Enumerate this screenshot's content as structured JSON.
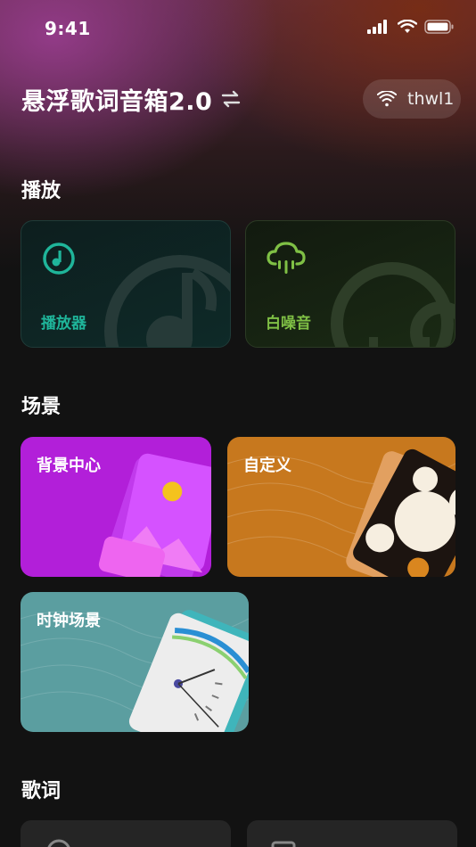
{
  "status_bar": {
    "time": "9:41"
  },
  "header": {
    "title": "悬浮歌词音箱2.0",
    "device_name": "thwl1"
  },
  "sections": {
    "play": "播放",
    "scene": "场景",
    "lyrics": "歌词"
  },
  "play_cards": {
    "player": {
      "label": "播放器",
      "color": "#1fb59a"
    },
    "white_noise": {
      "label": "白噪音",
      "color": "#7fc045"
    }
  },
  "scene_cards": {
    "background_center": {
      "label": "背景中心",
      "color": "#b21fd9"
    },
    "custom": {
      "label": "自定义",
      "color": "#c7781e"
    },
    "clock_scene": {
      "label": "时钟场景",
      "color": "#5b9ea0"
    }
  },
  "icons": {
    "signal": "cellular-signal-icon",
    "wifi": "wifi-icon",
    "battery": "battery-icon",
    "switch": "switch-arrows-icon",
    "player": "music-player-icon",
    "noise": "rain-cloud-icon"
  }
}
